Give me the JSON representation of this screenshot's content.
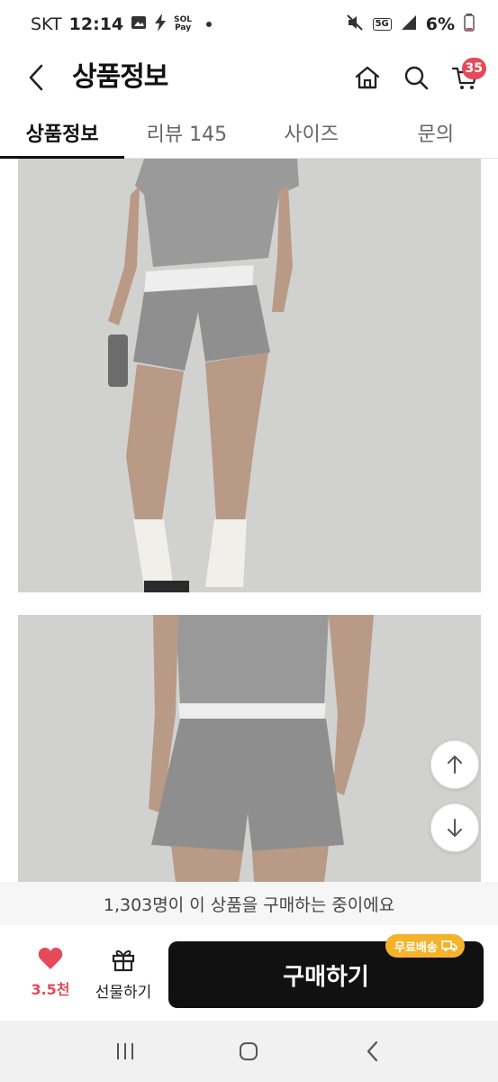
{
  "status_bar": {
    "carrier": "SKT",
    "time": "12:14",
    "pay_label_top": "SOL",
    "pay_label_bottom": "Pay",
    "network": "5G",
    "battery": "6%"
  },
  "header": {
    "title": "상품정보",
    "cart_count": "35"
  },
  "tabs": [
    {
      "label": "상품정보",
      "active": true
    },
    {
      "label": "리뷰 145",
      "active": false
    },
    {
      "label": "사이즈",
      "active": false
    },
    {
      "label": "문의",
      "active": false
    }
  ],
  "notice": {
    "text": "1,303명이 이 상품을 구매하는 중이에요"
  },
  "action_bar": {
    "like_count": "3.5천",
    "gift_label": "선물하기",
    "buy_label": "구매하기",
    "shipping_badge": "무료배송"
  },
  "colors": {
    "accent": "#e34a5a",
    "buy_button": "#111111",
    "shipping_badge": "#f5b32b"
  }
}
